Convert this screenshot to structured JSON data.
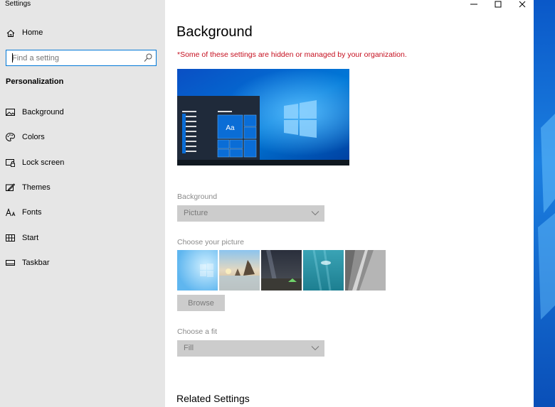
{
  "window": {
    "app_title": "Settings",
    "controls": [
      "minimize",
      "maximize",
      "close"
    ]
  },
  "sidebar": {
    "home_label": "Home",
    "search_placeholder": "Find a setting",
    "section_title": "Personalization",
    "items": [
      {
        "label": "Background",
        "icon": "picture-icon",
        "selected": true
      },
      {
        "label": "Colors",
        "icon": "palette-icon"
      },
      {
        "label": "Lock screen",
        "icon": "lock-screen-icon"
      },
      {
        "label": "Themes",
        "icon": "themes-brush-icon"
      },
      {
        "label": "Fonts",
        "icon": "fonts-icon"
      },
      {
        "label": "Start",
        "icon": "start-icon"
      },
      {
        "label": "Taskbar",
        "icon": "taskbar-icon"
      }
    ]
  },
  "main": {
    "title": "Background",
    "notice": "*Some of these settings are hidden or managed by your organization.",
    "preview_sample_text": "Aa",
    "background_label": "Background",
    "background_value": "Picture",
    "choose_picture_label": "Choose your picture",
    "browse_label": "Browse",
    "fit_label": "Choose a fit",
    "fit_value": "Fill",
    "related_title": "Related Settings"
  },
  "colors": {
    "accent": "#0078d7",
    "notice_red": "#c50f1f",
    "sidebar_bg": "#e6e6e6",
    "disabled_control": "#cccccc"
  }
}
